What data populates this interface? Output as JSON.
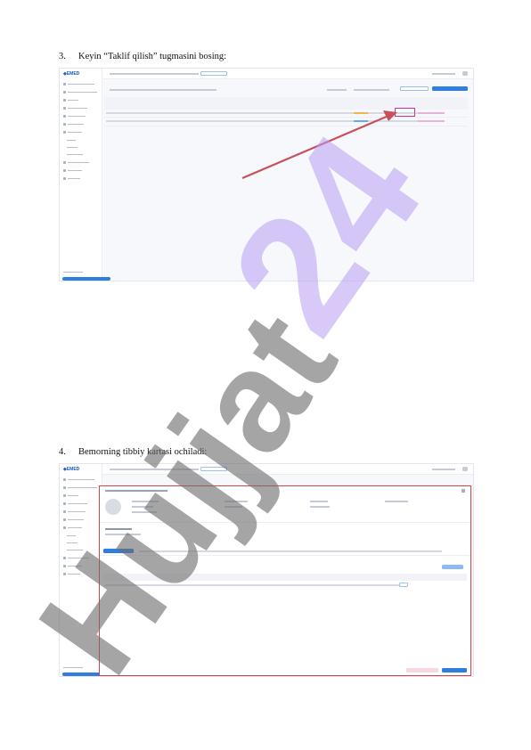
{
  "steps": [
    {
      "number": "3.",
      "text": "Keyin “Taklif qilish” tugmasini bosing:"
    },
    {
      "number": "4.",
      "text": "Bemorning tibbiy kartasi ochiladi:"
    }
  ],
  "app": {
    "logo": "◈EMED"
  },
  "watermark": {
    "text": "Hujjat",
    "number": "24",
    "text_color": "#6e6e6e",
    "number_color": "#b89cf2"
  },
  "colors": {
    "accent": "#2f7de1",
    "highlight": "#c23a8f",
    "arrow": "#c8505a",
    "modal_border": "#d64545"
  }
}
